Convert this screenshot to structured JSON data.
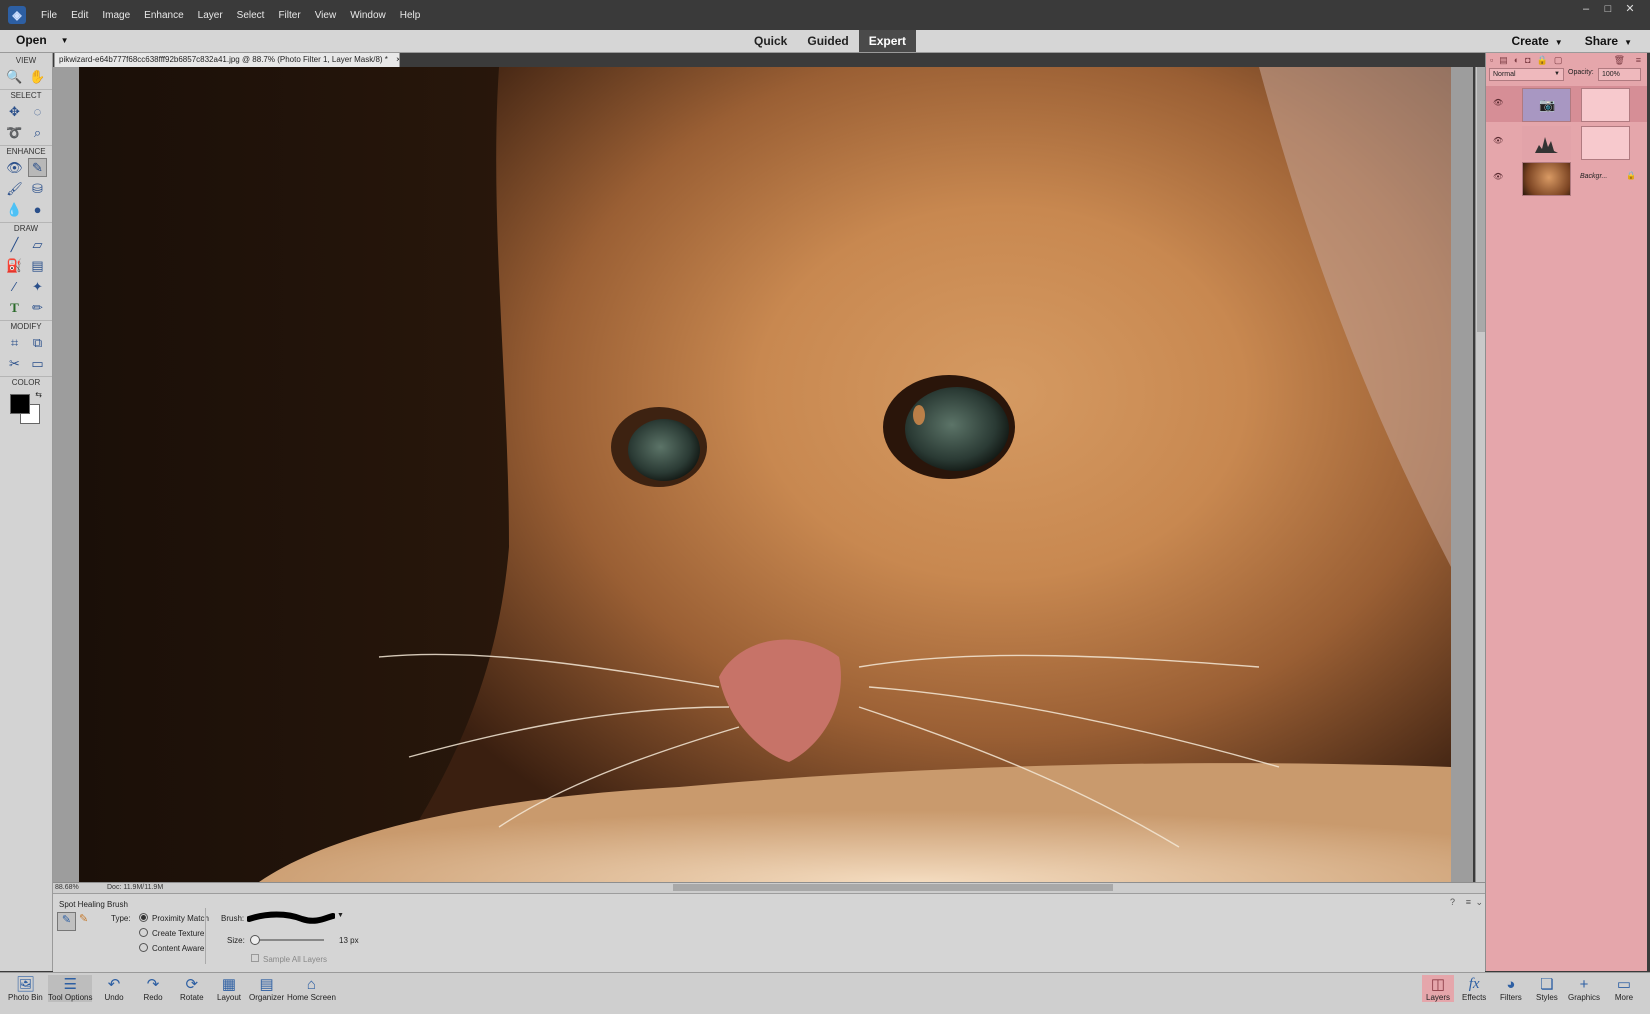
{
  "menubar": {
    "items": [
      "File",
      "Edit",
      "Image",
      "Enhance",
      "Layer",
      "Select",
      "Filter",
      "View",
      "Window",
      "Help"
    ],
    "window_controls": [
      "–",
      "□",
      "✕"
    ]
  },
  "modebar": {
    "open_label": "Open",
    "modes": [
      {
        "label": "Quick",
        "active": false
      },
      {
        "label": "Guided",
        "active": false
      },
      {
        "label": "Expert",
        "active": true
      }
    ],
    "create_label": "Create",
    "share_label": "Share"
  },
  "toolbox": {
    "sections": [
      "VIEW",
      "SELECT",
      "ENHANCE",
      "DRAW",
      "MODIFY",
      "COLOR"
    ]
  },
  "document": {
    "tab_title": "pikwizard-e64b777f68cc638fff92b6857c832a41.jpg @ 88.7% (Photo Filter 1, Layer Mask/8) *",
    "close_glyph": "×",
    "zoom": "88.68%",
    "doc_size": "Doc: 11.9M/11.9M"
  },
  "tool_options": {
    "tool_name": "Spot Healing Brush",
    "type_label": "Type:",
    "types": [
      {
        "label": "Proximity Match",
        "checked": true
      },
      {
        "label": "Create Texture",
        "checked": false
      },
      {
        "label": "Content Aware",
        "checked": false
      }
    ],
    "brush_label": "Brush:",
    "size_label": "Size:",
    "size_value": "13 px",
    "size_fraction": 0.05,
    "sample_all_layers": "Sample All Layers"
  },
  "layers": {
    "blend_mode": "Normal",
    "opacity_label": "Opacity:",
    "opacity_value": "100%",
    "items": [
      {
        "name": "Photo Filter 1",
        "kind": "adjustment-photo-filter",
        "selected": true
      },
      {
        "name": "Levels",
        "kind": "adjustment-levels",
        "selected": false
      },
      {
        "name": "Backgr...",
        "kind": "background",
        "selected": false
      }
    ]
  },
  "bottom_bar": {
    "left": [
      {
        "label": "Photo Bin",
        "icon": "photo-bin-icon"
      },
      {
        "label": "Tool Options",
        "icon": "tool-options-icon"
      },
      {
        "label": "Undo",
        "icon": "undo-icon"
      },
      {
        "label": "Redo",
        "icon": "redo-icon"
      },
      {
        "label": "Rotate",
        "icon": "rotate-icon"
      },
      {
        "label": "Layout",
        "icon": "layout-icon"
      },
      {
        "label": "Organizer",
        "icon": "organizer-icon"
      },
      {
        "label": "Home Screen",
        "icon": "home-icon"
      }
    ],
    "right": [
      {
        "label": "Layers",
        "icon": "layers-icon"
      },
      {
        "label": "Effects",
        "icon": "effects-icon"
      },
      {
        "label": "Filters",
        "icon": "filters-icon"
      },
      {
        "label": "Styles",
        "icon": "styles-icon"
      },
      {
        "label": "Graphics",
        "icon": "graphics-icon"
      },
      {
        "label": "More",
        "icon": "more-icon"
      }
    ]
  },
  "colors": {
    "panel_pink": "#e5a6ab",
    "accent_blue": "#2d5fa3",
    "foreground": "#000000",
    "background": "#ffffff"
  }
}
